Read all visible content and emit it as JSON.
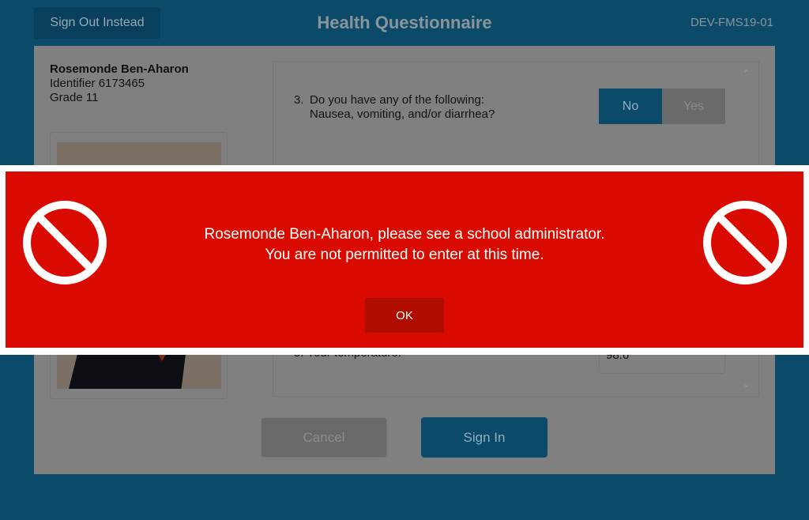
{
  "header": {
    "sign_out_label": "Sign Out Instead",
    "title": "Health Questionnaire",
    "device_id": "DEV-FMS19-01"
  },
  "student": {
    "name": "Rosemonde Ben-Aharon",
    "identifier": "Identifier 6173465",
    "grade": "Grade 11"
  },
  "questions": [
    {
      "number": "3.",
      "line1": "Do you have any of the following:",
      "line2": "Nausea, vomiting, and/or diarrhea?",
      "options": [
        "No",
        "Yes"
      ],
      "selected": "No"
    },
    {
      "number": "5.",
      "text": "Your temperature:",
      "value": "98.6"
    }
  ],
  "actions": {
    "cancel": "Cancel",
    "sign_in": "Sign In"
  },
  "alert": {
    "line1": "Rosemonde Ben-Aharon, please see a school administrator.",
    "line2": "You are not permitted to enter at this time.",
    "ok": "OK",
    "color": "#d90b00",
    "icon": "no-entry-icon"
  }
}
